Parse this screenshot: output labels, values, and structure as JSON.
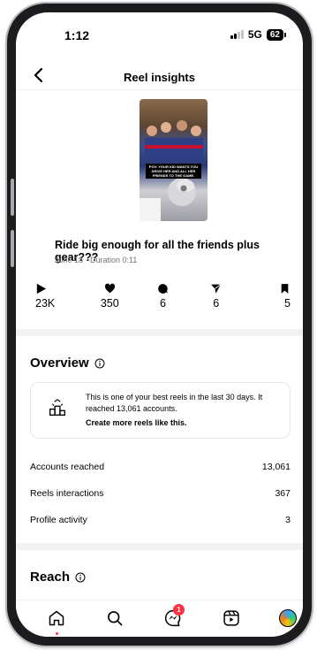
{
  "status_bar": {
    "time": "1:12",
    "network": "5G",
    "battery": "62"
  },
  "header": {
    "title": "Reel insights"
  },
  "reel": {
    "thumbnail_caption": "POV: YOUR KID WANTS YOU DRIVE HER AND ALL HER FRIENDS TO THE GAME.",
    "title": "Ride big enough for all the friends plus gear???",
    "meta": "June 18 · Duration 0:11"
  },
  "stats": [
    {
      "icon": "play-icon",
      "value": "23K"
    },
    {
      "icon": "heart-icon",
      "value": "350"
    },
    {
      "icon": "comment-icon",
      "value": "6"
    },
    {
      "icon": "share-icon",
      "value": "6"
    },
    {
      "icon": "bookmark-icon",
      "value": "5"
    }
  ],
  "overview": {
    "title": "Overview",
    "card_text": "This is one of your best reels in the last 30 days. It reached 13,061 accounts.",
    "card_link": "Create more reels like this.",
    "metrics": [
      {
        "label": "Accounts reached",
        "value": "13,061"
      },
      {
        "label": "Reels interactions",
        "value": "367"
      },
      {
        "label": "Profile activity",
        "value": "3"
      }
    ]
  },
  "reach": {
    "title": "Reach"
  },
  "tab_bar": {
    "messages_badge": "1"
  }
}
